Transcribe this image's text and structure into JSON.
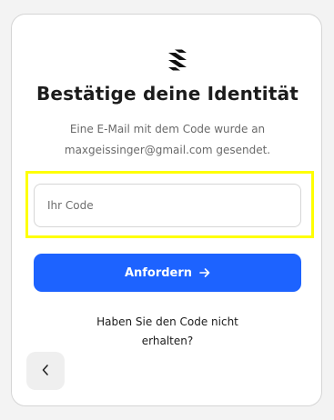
{
  "brand": {
    "logo_icon": "brand-logo-icon"
  },
  "header": {
    "title": "Bestätige deine Identität",
    "subtitle_line1": "Eine E-Mail mit dem Code wurde an",
    "subtitle_line2": "maxgeissinger@gmail.com gesendet."
  },
  "form": {
    "code_placeholder": "Ihr Code",
    "code_value": "",
    "submit_label": "Anfordern",
    "submit_icon": "arrow-right-icon"
  },
  "resend": {
    "line1": "Haben Sie den Code nicht",
    "line2": "erhalten?"
  },
  "nav": {
    "back_icon": "chevron-left-icon"
  },
  "colors": {
    "accent": "#1d63ff",
    "highlight": "#ffff00",
    "background": "#f3f3f3"
  }
}
